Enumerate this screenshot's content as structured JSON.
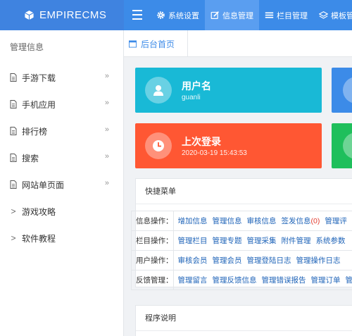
{
  "brand": {
    "name": "EMPIRECMS"
  },
  "nav": {
    "items": [
      {
        "label": "系统设置",
        "icon": "gear-icon"
      },
      {
        "label": "信息管理",
        "icon": "edit-icon"
      },
      {
        "label": "栏目管理",
        "icon": "list-icon"
      },
      {
        "label": "模板管理",
        "icon": "layers-icon"
      }
    ]
  },
  "sidebar": {
    "heading": "管理信息",
    "items": [
      {
        "label": "手游下载",
        "more": "»"
      },
      {
        "label": "手机应用",
        "more": "»"
      },
      {
        "label": "排行榜",
        "more": "»"
      },
      {
        "label": "搜索",
        "more": "»"
      },
      {
        "label": "网站单页面",
        "more": "»"
      },
      {
        "label": "游戏攻略",
        "arrow": ">"
      },
      {
        "label": "软件教程",
        "arrow": ">"
      }
    ]
  },
  "tabs": {
    "home": "后台首页"
  },
  "cards": {
    "user": {
      "title": "用户名",
      "value": "guanli",
      "color": "#19b9d6"
    },
    "last_login": {
      "title": "上次登录",
      "value": "2020-03-19 15:43:53",
      "color": "#ff5733"
    },
    "blue_color": "#3c8be8",
    "green_color": "#1fbf5c"
  },
  "quick": {
    "title": "快捷菜单",
    "rows": [
      {
        "label": "信息操作：",
        "links": [
          "增加信息",
          "管理信息",
          "审核信息",
          "签发信息",
          "(0)",
          "管理评"
        ]
      },
      {
        "label": "栏目操作：",
        "links": [
          "管理栏目",
          "管理专题",
          "管理采集",
          "附件管理",
          "系统参数"
        ]
      },
      {
        "label": "用户操作：",
        "links": [
          "审核会员",
          "管理会员",
          "管理登陆日志",
          "管理操作日志"
        ]
      },
      {
        "label": "反馈管理：",
        "links": [
          "管理留言",
          "管理反馈信息",
          "管理错误报告",
          "管理订单",
          "管理"
        ]
      }
    ]
  },
  "program": {
    "title": "程序说明"
  }
}
